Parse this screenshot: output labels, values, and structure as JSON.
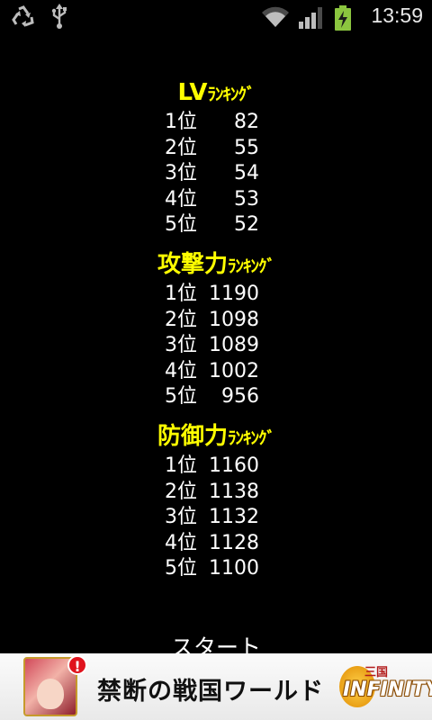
{
  "status_bar": {
    "time": "13:59",
    "icons": [
      "recycle-icon",
      "usb-icon",
      "wifi-icon",
      "signal-icon",
      "battery-charging-icon"
    ],
    "colors": {
      "battery": "#8bc53f",
      "icons": "#bdbdbd"
    }
  },
  "rankings": [
    {
      "title_main": "LV",
      "title_kana": "ﾗﾝｷﾝｸﾞ",
      "rows": [
        {
          "rank": "1位",
          "value": "82"
        },
        {
          "rank": "2位",
          "value": "55"
        },
        {
          "rank": "3位",
          "value": "54"
        },
        {
          "rank": "4位",
          "value": "53"
        },
        {
          "rank": "5位",
          "value": "52"
        }
      ]
    },
    {
      "title_main": "攻撃力",
      "title_kana": "ﾗﾝｷﾝｸﾞ",
      "rows": [
        {
          "rank": "1位",
          "value": "1190"
        },
        {
          "rank": "2位",
          "value": "1098"
        },
        {
          "rank": "3位",
          "value": "1089"
        },
        {
          "rank": "4位",
          "value": "1002"
        },
        {
          "rank": "5位",
          "value": "956"
        }
      ]
    },
    {
      "title_main": "防御力",
      "title_kana": "ﾗﾝｷﾝｸﾞ",
      "rows": [
        {
          "rank": "1位",
          "value": "1160"
        },
        {
          "rank": "2位",
          "value": "1138"
        },
        {
          "rank": "3位",
          "value": "1132"
        },
        {
          "rank": "4位",
          "value": "1128"
        },
        {
          "rank": "5位",
          "value": "1100"
        }
      ]
    }
  ],
  "start_label": "スタート",
  "ad": {
    "badge": "!",
    "text": "禁断の戦国ワールド",
    "logo_sub": "三国",
    "logo_main": "INFINITY"
  },
  "theme": {
    "background": "#000000",
    "title_color": "#ffff00",
    "text_color": "#ffffff"
  }
}
